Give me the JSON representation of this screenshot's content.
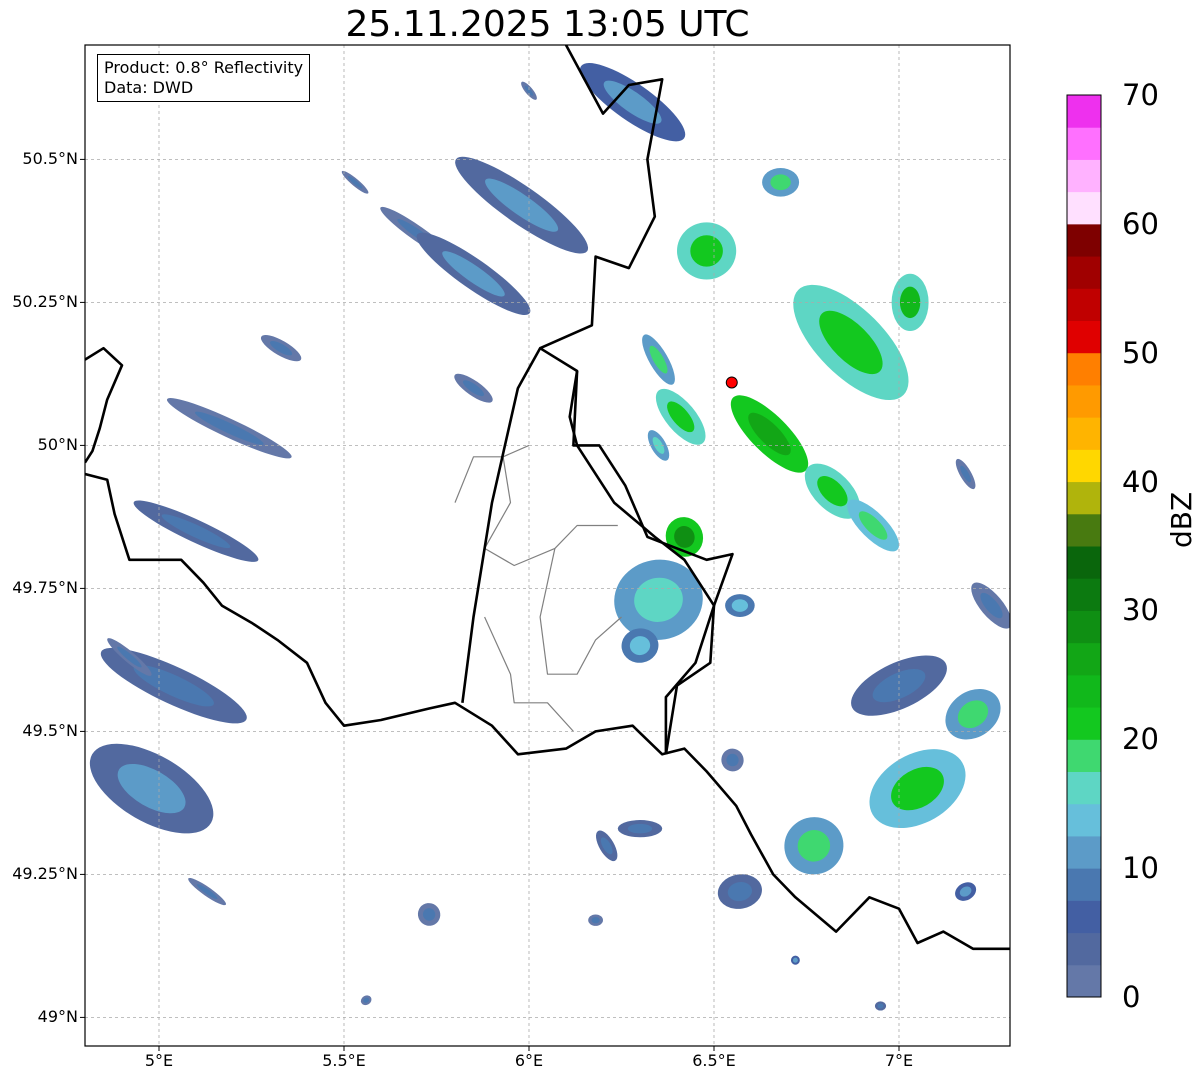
{
  "title": "25.11.2025 13:05 UTC",
  "info": {
    "product": "Product: 0.8° Reflectivity",
    "source": "Data: DWD"
  },
  "axes": {
    "lon_range": [
      4.8,
      7.3
    ],
    "lat_range": [
      48.95,
      50.7
    ],
    "lat_ticks": [
      {
        "value": 50.5,
        "label": "50.5°N"
      },
      {
        "value": 50.25,
        "label": "50.25°N"
      },
      {
        "value": 50.0,
        "label": "50°N"
      },
      {
        "value": 49.75,
        "label": "49.75°N"
      },
      {
        "value": 49.5,
        "label": "49.5°N"
      },
      {
        "value": 49.25,
        "label": "49.25°N"
      },
      {
        "value": 49.0,
        "label": "49°N"
      }
    ],
    "lon_ticks": [
      {
        "value": 5.0,
        "label": "5°E"
      },
      {
        "value": 5.5,
        "label": "5.5°E"
      },
      {
        "value": 6.0,
        "label": "6°E"
      },
      {
        "value": 6.5,
        "label": "6.5°E"
      },
      {
        "value": 7.0,
        "label": "7°E"
      }
    ],
    "grid": true
  },
  "radar_site": {
    "lon": 6.548,
    "lat": 50.11,
    "color": "#ff0000"
  },
  "colorbar": {
    "label": "dBZ",
    "min": 0,
    "max": 70,
    "ticks": [
      {
        "value": 0,
        "label": "0"
      },
      {
        "value": 10,
        "label": "10"
      },
      {
        "value": 20,
        "label": "20"
      },
      {
        "value": 30,
        "label": "30"
      },
      {
        "value": 40,
        "label": "40"
      },
      {
        "value": 50,
        "label": "50"
      },
      {
        "value": 60,
        "label": "60"
      },
      {
        "value": 70,
        "label": "70"
      }
    ],
    "colors": [
      "#6478a8",
      "#52699f",
      "#435fa3",
      "#4a78b0",
      "#5c9bc8",
      "#66bfdb",
      "#5ed6c4",
      "#3fd870",
      "#13c81f",
      "#11b81b",
      "#12a616",
      "#0f8f13",
      "#0c7a10",
      "#0a660c",
      "#487a10",
      "#b0b40c",
      "#ffd700",
      "#ffb400",
      "#ff9a00",
      "#ff7f00",
      "#e00000",
      "#c00000",
      "#a00000",
      "#7e0000",
      "#ffe0ff",
      "#ffb2ff",
      "#ff70ff",
      "#ee30ee"
    ]
  },
  "echoes": [
    {
      "lon": 4.98,
      "lat": 49.4,
      "rx": 0.09,
      "ry": 0.12,
      "rot": -60,
      "dbz": 10
    },
    {
      "lon": 5.04,
      "lat": 49.58,
      "rx": 0.05,
      "ry": 0.14,
      "rot": -65,
      "dbz": 9
    },
    {
      "lon": 5.1,
      "lat": 49.85,
      "rx": 0.03,
      "ry": 0.12,
      "rot": -65,
      "dbz": 9
    },
    {
      "lon": 5.19,
      "lat": 50.03,
      "rx": 0.025,
      "ry": 0.12,
      "rot": -65,
      "dbz": 8
    },
    {
      "lon": 5.33,
      "lat": 50.17,
      "rx": 0.02,
      "ry": 0.04,
      "rot": -60,
      "dbz": 8
    },
    {
      "lon": 4.92,
      "lat": 49.63,
      "rx": 0.015,
      "ry": 0.05,
      "rot": -50,
      "dbz": 8
    },
    {
      "lon": 5.13,
      "lat": 49.22,
      "rx": 0.012,
      "ry": 0.04,
      "rot": -55,
      "dbz": 8
    },
    {
      "lon": 5.7,
      "lat": 50.37,
      "rx": 0.02,
      "ry": 0.08,
      "rot": -55,
      "dbz": 8
    },
    {
      "lon": 5.85,
      "lat": 50.3,
      "rx": 0.04,
      "ry": 0.12,
      "rot": -55,
      "dbz": 10
    },
    {
      "lon": 5.98,
      "lat": 50.42,
      "rx": 0.05,
      "ry": 0.14,
      "rot": -55,
      "dbz": 10
    },
    {
      "lon": 6.28,
      "lat": 50.6,
      "rx": 0.05,
      "ry": 0.11,
      "rot": -55,
      "dbz": 11
    },
    {
      "lon": 6.0,
      "lat": 50.62,
      "rx": 0.01,
      "ry": 0.02,
      "rot": -40,
      "dbz": 8
    },
    {
      "lon": 5.53,
      "lat": 50.46,
      "rx": 0.01,
      "ry": 0.03,
      "rot": -50,
      "dbz": 8
    },
    {
      "lon": 5.85,
      "lat": 50.1,
      "rx": 0.02,
      "ry": 0.04,
      "rot": -55,
      "dbz": 8
    },
    {
      "lon": 6.48,
      "lat": 50.34,
      "rx": 0.08,
      "ry": 0.05,
      "rot": 0,
      "dbz": 21
    },
    {
      "lon": 6.68,
      "lat": 50.46,
      "rx": 0.05,
      "ry": 0.025,
      "rot": 0,
      "dbz": 18
    },
    {
      "lon": 6.87,
      "lat": 50.18,
      "rx": 0.09,
      "ry": 0.13,
      "rot": -45,
      "dbz": 21
    },
    {
      "lon": 7.03,
      "lat": 50.25,
      "rx": 0.05,
      "ry": 0.05,
      "rot": 0,
      "dbz": 23
    },
    {
      "lon": 6.65,
      "lat": 50.02,
      "rx": 0.05,
      "ry": 0.09,
      "rot": -45,
      "dbz": 26
    },
    {
      "lon": 6.82,
      "lat": 49.92,
      "rx": 0.05,
      "ry": 0.06,
      "rot": -45,
      "dbz": 22
    },
    {
      "lon": 6.93,
      "lat": 49.86,
      "rx": 0.035,
      "ry": 0.06,
      "rot": -45,
      "dbz": 19
    },
    {
      "lon": 6.41,
      "lat": 50.05,
      "rx": 0.04,
      "ry": 0.06,
      "rot": -40,
      "dbz": 21
    },
    {
      "lon": 6.35,
      "lat": 50.15,
      "rx": 0.025,
      "ry": 0.05,
      "rot": -30,
      "dbz": 18
    },
    {
      "lon": 6.35,
      "lat": 50.0,
      "rx": 0.02,
      "ry": 0.03,
      "rot": -30,
      "dbz": 17
    },
    {
      "lon": 6.42,
      "lat": 49.84,
      "rx": 0.05,
      "ry": 0.035,
      "rot": -20,
      "dbz": 28
    },
    {
      "lon": 6.35,
      "lat": 49.73,
      "rx": 0.12,
      "ry": 0.07,
      "rot": -10,
      "dbz": 17
    },
    {
      "lon": 6.3,
      "lat": 49.65,
      "rx": 0.05,
      "ry": 0.03,
      "rot": -10,
      "dbz": 14
    },
    {
      "lon": 6.57,
      "lat": 49.72,
      "rx": 0.04,
      "ry": 0.02,
      "rot": 0,
      "dbz": 14
    },
    {
      "lon": 6.77,
      "lat": 49.3,
      "rx": 0.08,
      "ry": 0.05,
      "rot": -15,
      "dbz": 18
    },
    {
      "lon": 6.57,
      "lat": 49.22,
      "rx": 0.06,
      "ry": 0.03,
      "rot": -10,
      "dbz": 9
    },
    {
      "lon": 7.05,
      "lat": 49.4,
      "rx": 0.14,
      "ry": 0.06,
      "rot": -30,
      "dbz": 20
    },
    {
      "lon": 7.0,
      "lat": 49.58,
      "rx": 0.14,
      "ry": 0.04,
      "rot": -25,
      "dbz": 9
    },
    {
      "lon": 7.2,
      "lat": 49.53,
      "rx": 0.08,
      "ry": 0.04,
      "rot": -35,
      "dbz": 18
    },
    {
      "lon": 7.25,
      "lat": 49.72,
      "rx": 0.03,
      "ry": 0.05,
      "rot": -40,
      "dbz": 8
    },
    {
      "lon": 6.55,
      "lat": 49.45,
      "rx": 0.03,
      "ry": 0.02,
      "rot": -20,
      "dbz": 8
    },
    {
      "lon": 6.3,
      "lat": 49.33,
      "rx": 0.06,
      "ry": 0.015,
      "rot": 0,
      "dbz": 9
    },
    {
      "lon": 6.21,
      "lat": 49.3,
      "rx": 0.02,
      "ry": 0.03,
      "rot": -30,
      "dbz": 9
    },
    {
      "lon": 5.73,
      "lat": 49.18,
      "rx": 0.03,
      "ry": 0.02,
      "rot": -30,
      "dbz": 8
    },
    {
      "lon": 6.18,
      "lat": 49.17,
      "rx": 0.02,
      "ry": 0.01,
      "rot": 0,
      "dbz": 8
    },
    {
      "lon": 7.18,
      "lat": 49.22,
      "rx": 0.03,
      "ry": 0.015,
      "rot": -30,
      "dbz": 12
    },
    {
      "lon": 6.95,
      "lat": 49.02,
      "rx": 0.015,
      "ry": 0.008,
      "rot": 0,
      "dbz": 9
    },
    {
      "lon": 6.72,
      "lat": 49.1,
      "rx": 0.012,
      "ry": 0.008,
      "rot": 0,
      "dbz": 12
    },
    {
      "lon": 5.56,
      "lat": 49.03,
      "rx": 0.015,
      "ry": 0.008,
      "rot": -30,
      "dbz": 8
    },
    {
      "lon": 7.18,
      "lat": 49.95,
      "rx": 0.015,
      "ry": 0.03,
      "rot": -30,
      "dbz": 8
    }
  ],
  "borders": {
    "national": [
      [
        [
          4.8,
          50.15
        ],
        [
          4.85,
          50.17
        ],
        [
          4.9,
          50.14
        ],
        [
          4.86,
          50.08
        ],
        [
          4.84,
          50.03
        ],
        [
          4.82,
          49.99
        ],
        [
          4.8,
          49.97
        ]
      ],
      [
        [
          4.8,
          49.95
        ],
        [
          4.86,
          49.94
        ],
        [
          4.88,
          49.88
        ],
        [
          4.92,
          49.8
        ],
        [
          4.98,
          49.8
        ],
        [
          5.06,
          49.8
        ],
        [
          5.12,
          49.76
        ],
        [
          5.17,
          49.72
        ],
        [
          5.25,
          49.69
        ],
        [
          5.32,
          49.66
        ],
        [
          5.4,
          49.62
        ],
        [
          5.45,
          49.55
        ],
        [
          5.5,
          49.51
        ],
        [
          5.6,
          49.52
        ],
        [
          5.73,
          49.54
        ],
        [
          5.8,
          49.55
        ],
        [
          5.9,
          49.51
        ],
        [
          5.97,
          49.46
        ],
        [
          6.1,
          49.47
        ],
        [
          6.18,
          49.5
        ],
        [
          6.28,
          49.51
        ],
        [
          6.36,
          49.46
        ],
        [
          6.42,
          49.47
        ],
        [
          6.48,
          49.43
        ],
        [
          6.56,
          49.37
        ],
        [
          6.6,
          49.32
        ],
        [
          6.66,
          49.25
        ],
        [
          6.72,
          49.21
        ],
        [
          6.83,
          49.15
        ],
        [
          6.92,
          49.21
        ],
        [
          7.0,
          49.19
        ],
        [
          7.05,
          49.13
        ],
        [
          7.12,
          49.15
        ],
        [
          7.2,
          49.12
        ],
        [
          7.3,
          49.12
        ]
      ],
      [
        [
          5.82,
          49.55
        ],
        [
          5.85,
          49.7
        ],
        [
          5.9,
          49.9
        ],
        [
          5.97,
          50.1
        ],
        [
          6.03,
          50.17
        ],
        [
          6.13,
          50.13
        ],
        [
          6.11,
          50.05
        ],
        [
          6.13,
          50.0
        ],
        [
          6.23,
          49.9
        ],
        [
          6.34,
          49.84
        ],
        [
          6.42,
          49.8
        ],
        [
          6.5,
          49.72
        ],
        [
          6.49,
          49.62
        ],
        [
          6.4,
          49.58
        ],
        [
          6.37,
          49.46
        ]
      ],
      [
        [
          6.03,
          50.17
        ],
        [
          6.17,
          50.21
        ],
        [
          6.18,
          50.33
        ],
        [
          6.27,
          50.31
        ],
        [
          6.34,
          50.4
        ],
        [
          6.32,
          50.5
        ],
        [
          6.36,
          50.64
        ],
        [
          6.27,
          50.63
        ],
        [
          6.2,
          50.58
        ],
        [
          6.1,
          50.7
        ]
      ],
      [
        [
          6.13,
          50.13
        ],
        [
          6.12,
          50.0
        ],
        [
          6.19,
          50.0
        ],
        [
          6.26,
          49.93
        ],
        [
          6.32,
          49.84
        ],
        [
          6.4,
          49.82
        ],
        [
          6.48,
          49.8
        ],
        [
          6.55,
          49.81
        ],
        [
          6.5,
          49.72
        ],
        [
          6.45,
          49.62
        ],
        [
          6.37,
          49.56
        ],
        [
          6.37,
          49.46
        ]
      ]
    ],
    "regional": [
      [
        [
          6.0,
          50.0
        ],
        [
          5.93,
          49.98
        ],
        [
          5.85,
          49.98
        ],
        [
          5.8,
          49.9
        ]
      ],
      [
        [
          5.93,
          49.98
        ],
        [
          5.95,
          49.9
        ],
        [
          5.88,
          49.82
        ],
        [
          5.96,
          49.79
        ],
        [
          6.07,
          49.82
        ],
        [
          6.13,
          49.86
        ],
        [
          6.24,
          49.86
        ]
      ],
      [
        [
          6.07,
          49.82
        ],
        [
          6.03,
          49.7
        ],
        [
          6.05,
          49.6
        ],
        [
          6.13,
          49.6
        ],
        [
          6.18,
          49.66
        ],
        [
          6.25,
          49.7
        ]
      ],
      [
        [
          5.88,
          49.7
        ],
        [
          5.95,
          49.6
        ],
        [
          5.96,
          49.55
        ],
        [
          6.05,
          49.55
        ],
        [
          6.12,
          49.5
        ]
      ]
    ]
  }
}
